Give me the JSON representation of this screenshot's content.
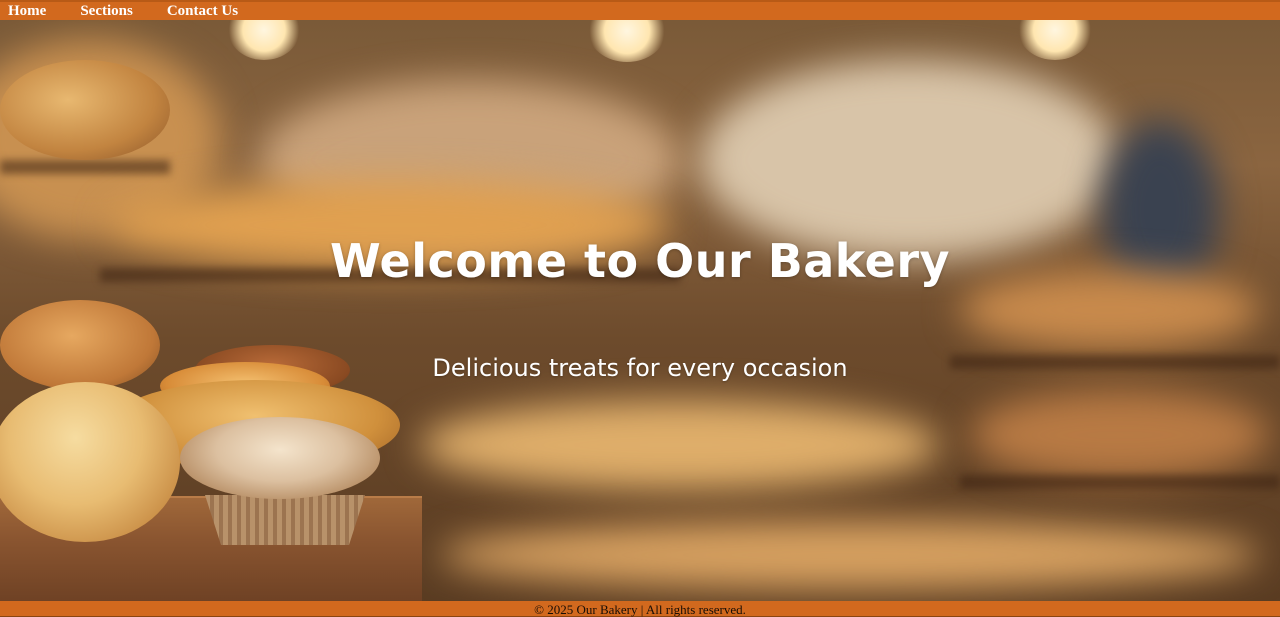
{
  "nav": {
    "home": "Home",
    "sections": "Sections",
    "contact": "Contact Us"
  },
  "hero": {
    "title": "Welcome to Our Bakery",
    "subtitle": "Delicious treats for every occasion"
  },
  "footer": {
    "text": "© 2025 Our Bakery | All rights reserved."
  },
  "colors": {
    "accent": "#d2691e",
    "text_light": "#ffffff"
  }
}
